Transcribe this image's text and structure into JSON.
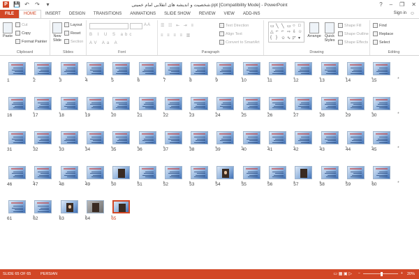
{
  "window": {
    "title": "شخصیت و اندیشه های انقلابی امام خمینی.ppt [Compatibility Mode] - PowerPoint",
    "minimize": "–",
    "restore": "❐",
    "close": "✕",
    "help": "?"
  },
  "qat": {
    "logo": "P",
    "save": "💾",
    "undo": "↶",
    "redo": "↷",
    "customize": "▾"
  },
  "tabs": [
    "FILE",
    "HOME",
    "INSERT",
    "DESIGN",
    "TRANSITIONS",
    "ANIMATIONS",
    "SLIDE SHOW",
    "REVIEW",
    "VIEW",
    "ADD-INS"
  ],
  "active_tab": "HOME",
  "signin": "Sign in",
  "ribbon": {
    "clipboard": {
      "label": "Clipboard",
      "paste": "Paste",
      "cut": "Cut",
      "copy": "Copy",
      "format_painter": "Format Painter"
    },
    "slides": {
      "label": "Slides",
      "new_slide": "New Slide",
      "layout": "Layout",
      "reset": "Reset",
      "section": "Section"
    },
    "font": {
      "label": "Font"
    },
    "paragraph": {
      "label": "Paragraph",
      "text_direction": "Text Direction",
      "align_text": "Align Text",
      "convert_smartart": "Convert to SmartArt"
    },
    "drawing": {
      "label": "Drawing",
      "arrange": "Arrange",
      "quick_styles": "Quick Styles",
      "shape_fill": "Shape Fill",
      "shape_outline": "Shape Outline",
      "shape_effects": "Shape Effects"
    },
    "editing": {
      "label": "Editing",
      "find": "Find",
      "replace": "Replace",
      "select": "Select"
    }
  },
  "slides": {
    "count": 65,
    "selected": 65,
    "star": "*",
    "photo_slides": [
      50,
      54,
      57,
      63,
      64,
      65
    ]
  },
  "status": {
    "slide_info": "SLIDE 65 OF 65",
    "language": "PERSIAN",
    "zoom": "20%"
  }
}
